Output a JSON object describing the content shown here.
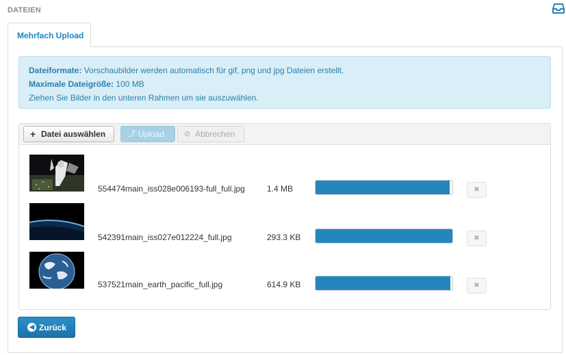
{
  "header": {
    "title": "DATEIEN",
    "icon": "inbox-icon"
  },
  "tabs": [
    {
      "label": "Mehrfach Upload",
      "active": true
    }
  ],
  "info": {
    "line1_label": "Dateiformate:",
    "line1_text": " Vorschaubilder werden automatisch für gif, png und jpg Dateien erstellt.",
    "line2_label": "Maximale Dateigröße:",
    "line2_text": " 100 MB",
    "line3_text": "Ziehen Sie Bilder in den unteren Rahmen um sie auszuwählen."
  },
  "toolbar": {
    "add_label": "Datei auswählen",
    "upload_label": "Upload",
    "cancel_label": "Abbrechen"
  },
  "files": [
    {
      "name": "554474main_iss028e006193-full_full.jpg",
      "size": "1.4 MB",
      "progress": 0.98
    },
    {
      "name": "542391main_iss027e012224_full.jpg",
      "size": "293.3 KB",
      "progress": 1.0
    },
    {
      "name": "537521main_earth_pacific_full.jpg",
      "size": "614.9 KB",
      "progress": 0.985
    }
  ],
  "back_label": "Zurück",
  "colors": {
    "accent": "#2486bd",
    "info_bg": "#d9eef6",
    "info_text": "#2a7fb0"
  }
}
